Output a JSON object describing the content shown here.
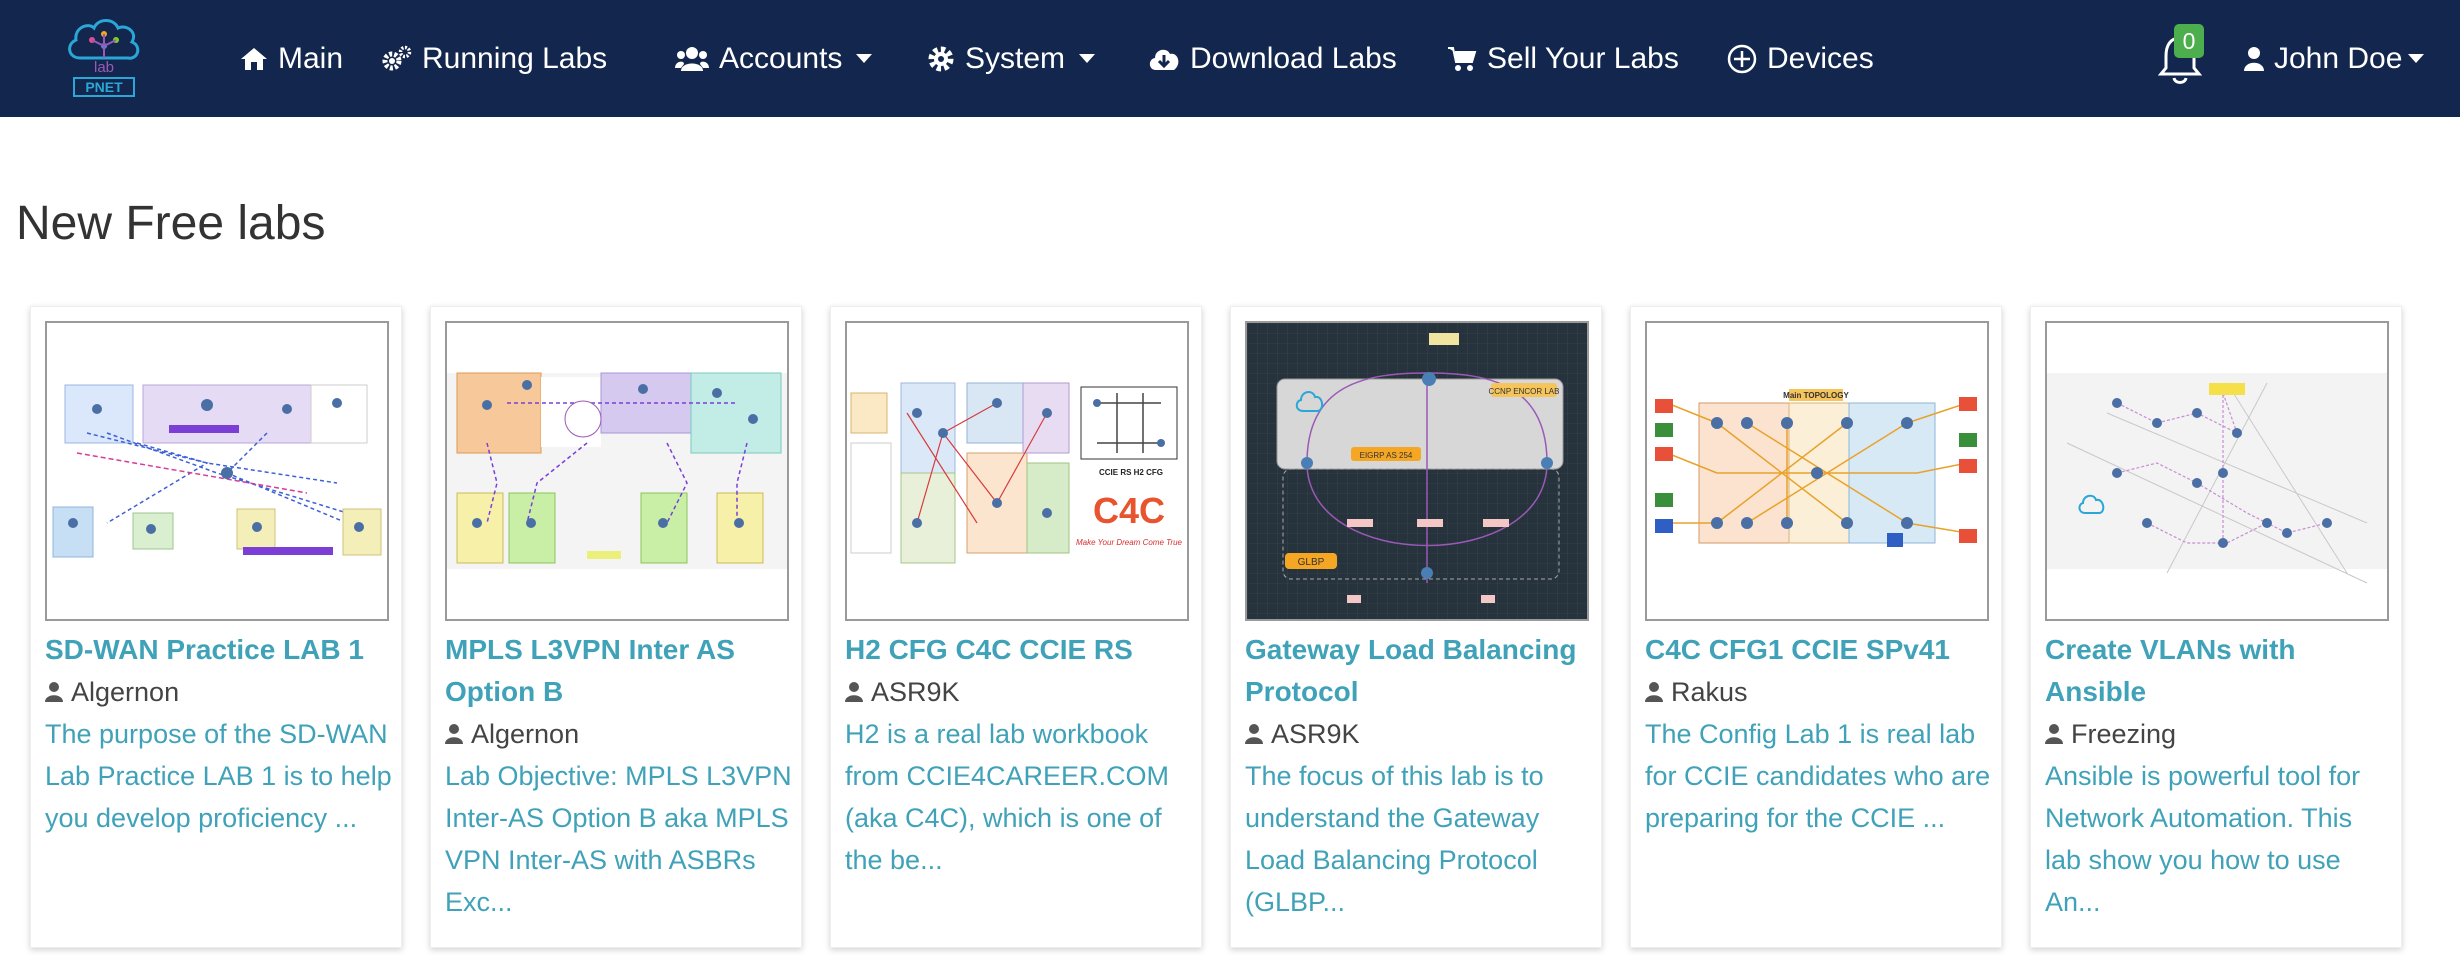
{
  "brand": {
    "logo_text_top": "lab",
    "logo_text_bottom": "PNET"
  },
  "nav": {
    "main": "Main",
    "running_labs": "Running Labs",
    "accounts": "Accounts",
    "system": "System",
    "download_labs": "Download Labs",
    "sell_labs": "Sell Your Labs",
    "devices": "Devices",
    "notifications_count": "0",
    "user": "John Doe"
  },
  "section": {
    "title": "New Free labs"
  },
  "cards": [
    {
      "title": "SD-WAN Practice LAB 1",
      "author": "Algernon",
      "desc": "The purpose of the SD-WAN Lab Practice LAB 1 is to help you develop proficiency ...",
      "thumb_icon": "sdwan-topology-icon"
    },
    {
      "title": "MPLS L3VPN Inter AS Option B",
      "author": "Algernon",
      "desc": "Lab Objective: MPLS L3VPN Inter-AS Option B aka MPLS VPN Inter-AS with ASBRs Exc...",
      "thumb_icon": "mpls-topology-icon"
    },
    {
      "title": "H2 CFG C4C CCIE RS",
      "author": "ASR9K",
      "desc": "H2 is a real lab workbook from CCIE4CAREER.COM (aka C4C), which is one of the be...",
      "thumb_icon": "ccie-rs-topology-icon",
      "thumb_caption": "CCIE RS H2 CFG",
      "thumb_logo": "C4C",
      "thumb_slogan": "Make Your Dream Come True"
    },
    {
      "title": "Gateway Load Balancing Protocol",
      "author": "ASR9K",
      "desc": "The focus of this lab is to understand the Gateway Load Balancing Protocol (GLBP...",
      "thumb_icon": "glbp-topology-icon",
      "thumb_label_lab": "CCNP ENCOR LAB",
      "thumb_label_eigrp": "EIGRP AS 254",
      "thumb_label_glbp": "GLBP"
    },
    {
      "title": "C4C CFG1 CCIE SPv41",
      "author": "Rakus",
      "desc": "The Config Lab 1 is real lab for CCIE candidates who are preparing for the CCIE ...",
      "thumb_icon": "ccie-sp-topology-icon",
      "thumb_caption": "Main TOPOLOGY"
    },
    {
      "title": "Create VLANs with Ansible",
      "author": "Freezing",
      "desc": "Ansible is powerful tool for Network Automation. This lab show you how to use An...",
      "thumb_icon": "ansible-topology-icon"
    }
  ],
  "colors": {
    "navbar": "#13264d",
    "link": "#3fa2b8",
    "badge": "#4cae4c",
    "text": "#333333"
  }
}
